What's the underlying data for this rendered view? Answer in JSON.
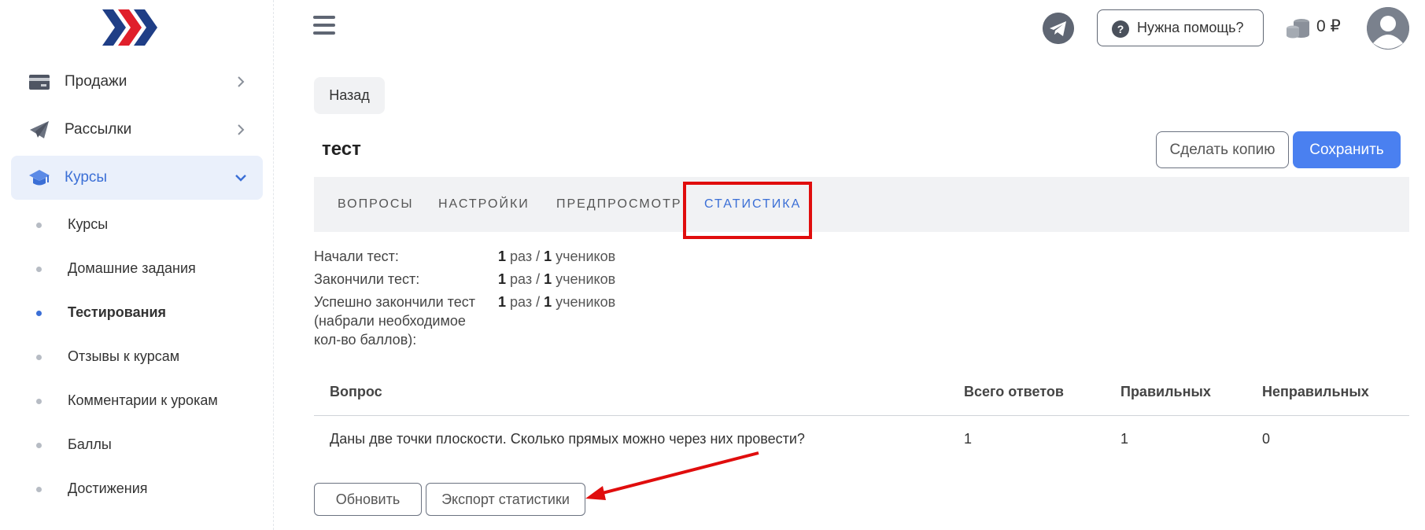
{
  "sidebar": {
    "items": [
      {
        "label": "Продажи",
        "icon": "card-icon"
      },
      {
        "label": "Рассылки",
        "icon": "paper-plane-icon"
      },
      {
        "label": "Курсы",
        "icon": "graduation-cap-icon"
      }
    ],
    "subitems": [
      {
        "label": "Курсы"
      },
      {
        "label": "Домашние задания"
      },
      {
        "label": "Тестирования"
      },
      {
        "label": "Отзывы к курсам"
      },
      {
        "label": "Комментарии к урокам"
      },
      {
        "label": "Баллы"
      },
      {
        "label": "Достижения"
      }
    ]
  },
  "header": {
    "help_label": "Нужна помощь?",
    "balance": "0 ₽"
  },
  "main": {
    "back_label": "Назад",
    "title": "тест",
    "copy_label": "Сделать копию",
    "save_label": "Сохранить",
    "tabs": [
      {
        "label": "ВОПРОСЫ"
      },
      {
        "label": "НАСТРОЙКИ"
      },
      {
        "label": "ПРЕДПРОСМОТР"
      },
      {
        "label": "СТАТИСТИКА"
      }
    ],
    "stats": [
      {
        "label": "Начали тест:",
        "times": "1",
        "times_unit": "раз /",
        "students": "1",
        "students_unit": "учеников"
      },
      {
        "label": "Закончили тест:",
        "times": "1",
        "times_unit": "раз /",
        "students": "1",
        "students_unit": "учеников"
      },
      {
        "label_lines": [
          "Успешно закончили тест",
          "(набрали необходимое",
          "кол-во баллов):"
        ],
        "times": "1",
        "times_unit": "раз /",
        "students": "1",
        "students_unit": "учеников"
      }
    ],
    "table": {
      "headers": [
        "Вопрос",
        "Всего ответов",
        "Правильных",
        "Неправильных"
      ],
      "rows": [
        [
          "Даны две точки плоскости. Сколько прямых можно через них провести?",
          "1",
          "1",
          "0"
        ]
      ]
    },
    "refresh_label": "Обновить",
    "export_label": "Экспорт статистики"
  },
  "colors": {
    "accent": "#4a80f0",
    "highlight": "#e00d0d",
    "active_text": "#3b6fd6"
  }
}
